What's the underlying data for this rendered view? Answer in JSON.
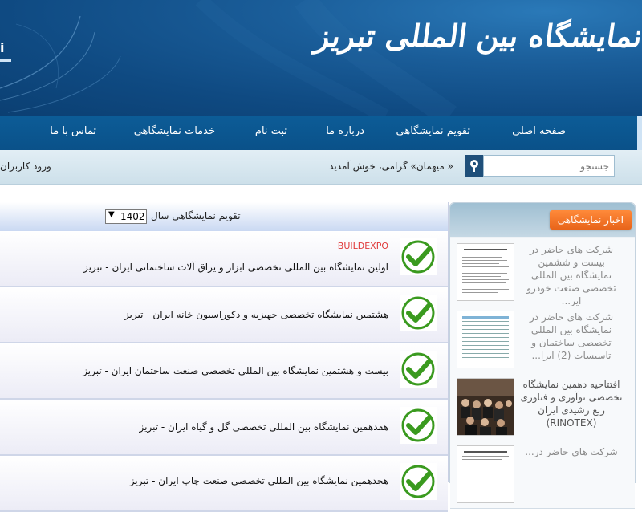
{
  "header": {
    "site_title": "نمایشگاه بین المللی تبریز",
    "logo_letter": "i"
  },
  "nav": {
    "items": [
      {
        "label": "صفحه اصلی"
      },
      {
        "label": "تقویم نمایشگاهی"
      },
      {
        "label": "درباره ما"
      },
      {
        "label": "ثبت نام"
      },
      {
        "label": "خدمات نمایشگاهی"
      },
      {
        "label": "تماس با ما"
      }
    ]
  },
  "search": {
    "placeholder": "جستجو"
  },
  "welcome_text": "« میهمان» گرامی، خوش آمدید",
  "login_label": "ورود کاربران",
  "calendar": {
    "title": "تقویم نمایشگاهی سال",
    "year": "1402",
    "events": [
      {
        "badge": "BUILDEXPO",
        "title": "اولین نمایشگاه بین المللی تخصصی ابزار و یراق آلات ساختمانی ایران - تبریز"
      },
      {
        "badge": "",
        "title": "هشتمین نمایشگاه تخصصی جهیزیه و دکوراسیون خانه ایران - تبریز"
      },
      {
        "badge": "",
        "title": "بیست و هشتمین نمایشگاه بین المللی تخصصی صنعت ساختمان ایران - تبریز"
      },
      {
        "badge": "",
        "title": "هفدهمین نمایشگاه بین المللی تخصصی گل و گیاه ایران - تبریز"
      },
      {
        "badge": "",
        "title": "هجدهمین نمایشگاه بین المللی تخصصی صنعت چاپ ایران - تبریز"
      }
    ]
  },
  "sidebar": {
    "title": "اخبار نمایشگاهی",
    "news": [
      {
        "text": "شرکت های حاضر در بیست و ششمین نمایشگاه بین المللی تخصصی صنعت خودرو ایر..."
      },
      {
        "text": "شرکت های حاضر در نمایشگاه بین المللی تخصصی ساختمان و تاسیسات (2) ایرا..."
      },
      {
        "text": "افتتاحیه دهمین نمایشگاه تخصصی نوآوری و فناوری ربع رشیدی ایران (RINOTEX)"
      },
      {
        "text": "شرکت های حاضر در..."
      }
    ]
  },
  "colors": {
    "banner": "#1a5d99",
    "nav": "#0c5c97",
    "accent_orange": "#e8641a",
    "check_green": "#3a9a1f",
    "badge_red": "#e03a3a"
  }
}
